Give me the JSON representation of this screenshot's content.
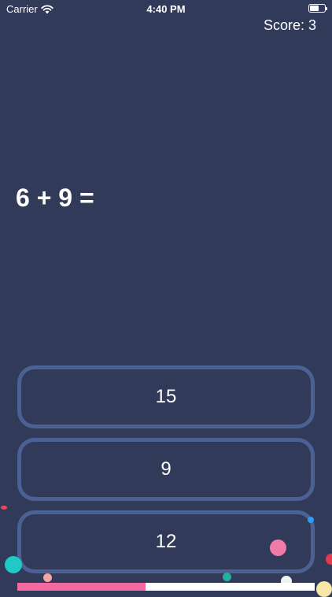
{
  "status_bar": {
    "carrier": "Carrier",
    "time": "4:40 PM"
  },
  "score": "Score: 3",
  "question": "6 + 9 =",
  "answers": [
    "15",
    "9",
    "12"
  ],
  "progress": {
    "fraction": 0.43,
    "fill_color": "#f26aa1"
  },
  "colors": {
    "background": "#323a5a",
    "button_border": "#4b6194"
  },
  "icons": [
    "wifi-icon",
    "battery-icon"
  ]
}
